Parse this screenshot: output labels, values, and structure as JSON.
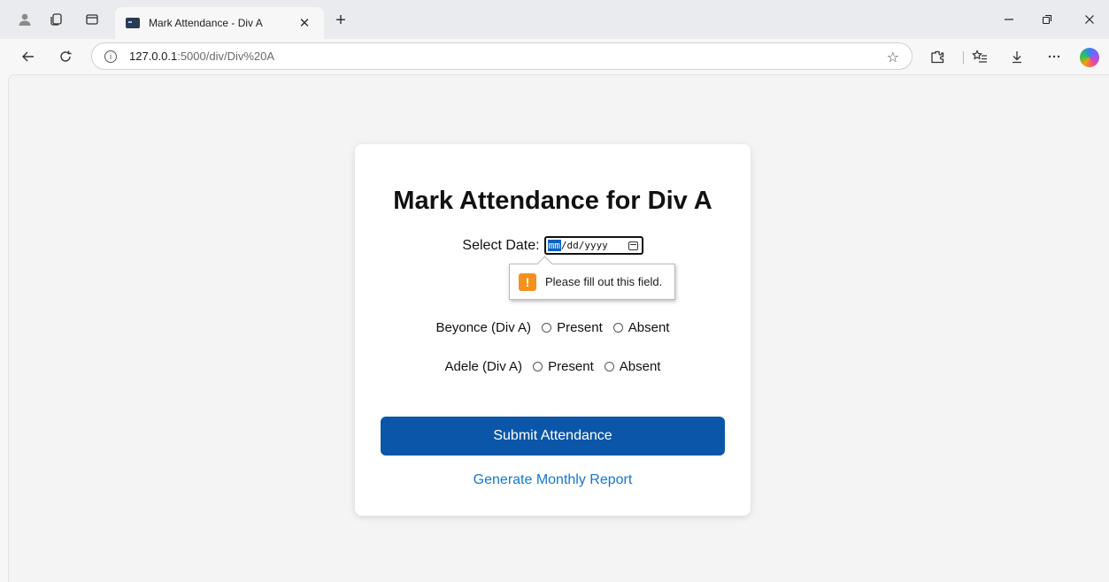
{
  "browser": {
    "tab_title": "Mark Attendance - Div A",
    "url_host": "127.0.0.1",
    "url_path": ":5000/div/Div%20A"
  },
  "page": {
    "title": "Mark Attendance for Div A",
    "date_label": "Select Date:",
    "date_placeholder": {
      "mm": "mm",
      "rest": "/dd/yyyy"
    },
    "validation_message": "Please fill out this field.",
    "students": [
      {
        "name": "Beyonce (Div A)",
        "present_label": "Present",
        "absent_label": "Absent"
      },
      {
        "name": "Adele (Div A)",
        "present_label": "Present",
        "absent_label": "Absent"
      }
    ],
    "submit_label": "Submit Attendance",
    "report_link": "Generate Monthly Report"
  },
  "colors": {
    "submit_bg": "#0b56a8",
    "link": "#1577d8",
    "warning": "#f5911e",
    "date_segment_highlight": "#0b63c4"
  }
}
